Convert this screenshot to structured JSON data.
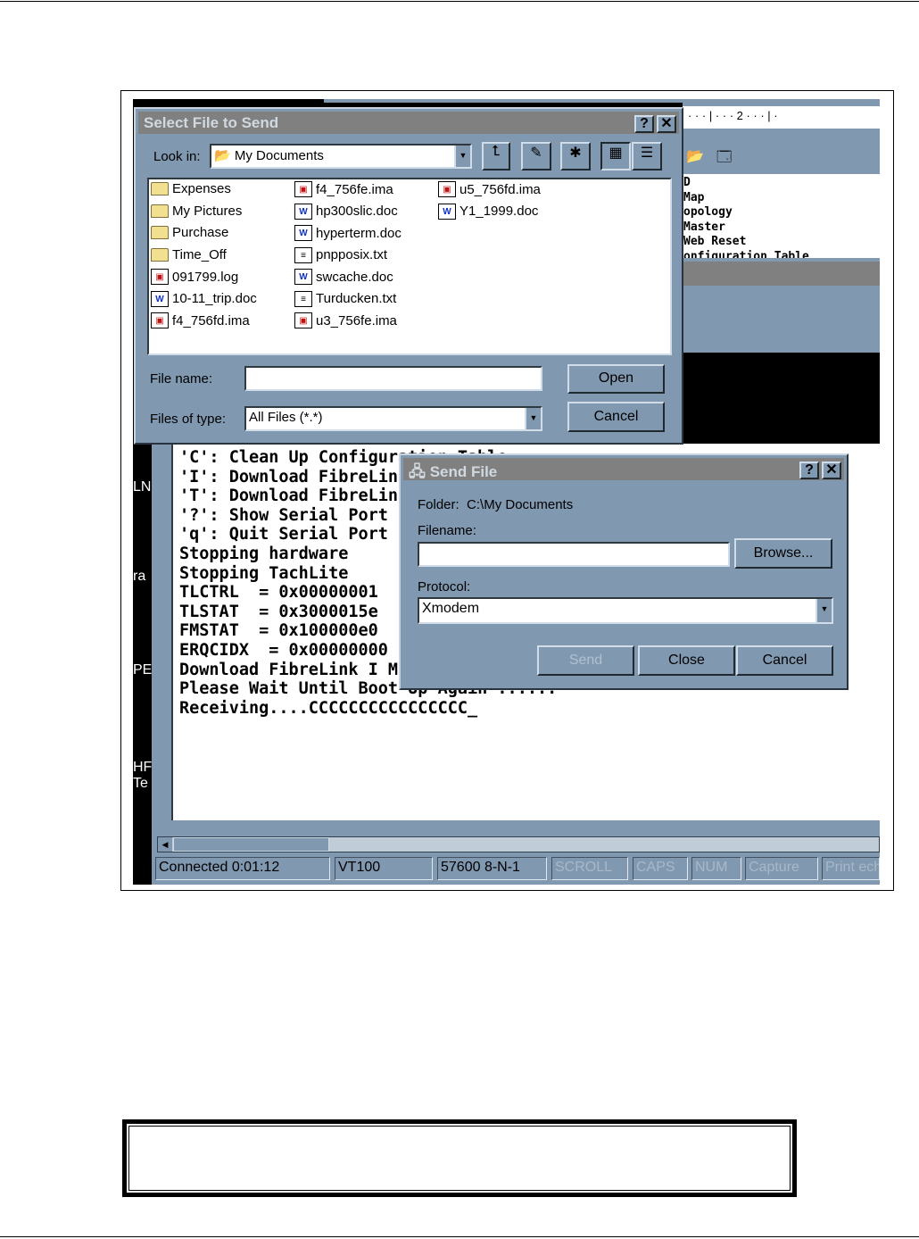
{
  "select_dialog": {
    "title": "Select File to Send",
    "look_in_label": "Look in:",
    "look_in_value": "My Documents",
    "files": [
      {
        "name": "Expenses",
        "type": "folder"
      },
      {
        "name": "My Pictures",
        "type": "folder"
      },
      {
        "name": "Purchase",
        "type": "folder"
      },
      {
        "name": "Time_Off",
        "type": "folder"
      },
      {
        "name": "091799.log",
        "type": "ima"
      },
      {
        "name": "10-11_trip.doc",
        "type": "doc"
      },
      {
        "name": "f4_756fd.ima",
        "type": "ima"
      },
      {
        "name": "f4_756fe.ima",
        "type": "ima"
      },
      {
        "name": "hp300slic.doc",
        "type": "doc"
      },
      {
        "name": "hyperterm.doc",
        "type": "doc"
      },
      {
        "name": "pnpposix.txt",
        "type": "txt"
      },
      {
        "name": "swcache.doc",
        "type": "doc"
      },
      {
        "name": "Turducken.txt",
        "type": "txt"
      },
      {
        "name": "u3_756fe.ima",
        "type": "ima"
      },
      {
        "name": "u5_756fd.ima",
        "type": "ima"
      },
      {
        "name": "Y1_1999.doc",
        "type": "doc"
      }
    ],
    "file_name_label": "File name:",
    "file_name_value": "",
    "files_of_type_label": "Files of type:",
    "files_of_type_value": "All Files (*.*)",
    "open_label": "Open",
    "cancel_label": "Cancel"
  },
  "background_app": {
    "ruler": "· · · | · · · 2 · · · | ·",
    "lines": [
      "D",
      "Map",
      "opology",
      "Master",
      "Web Reset",
      "onfiguration Table"
    ]
  },
  "terminal": {
    "lines": [
      "'C': Clean Up Configuration Table",
      "'I': Download FibreLink I Microcode",
      "'T': Download FibreLink T Microcode",
      "'?': Show Serial Port",
      "'q': Quit Serial Port",
      "Stopping hardware",
      "Stopping TachLite",
      "TLCTRL  = 0x00000001",
      "TLSTAT  = 0x3000015e",
      "FMSTAT  = 0x100000e0",
      "ERQCIDX  = 0x00000000",
      "",
      "Download FibreLink I Microcode From Local Computer",
      "",
      "",
      "Please Wait Until Boot Up Again ......",
      "",
      "",
      "Receiving....CCCCCCCCCCCCCCCC_"
    ],
    "desktop_labels": [
      "LN",
      "ra",
      "PE",
      "HF",
      "Te"
    ]
  },
  "status_bar": [
    "Connected 0:01:12",
    "VT100",
    "57600 8-N-1",
    "SCROLL",
    "CAPS",
    "NUM",
    "Capture",
    "Print ech"
  ],
  "send_dialog": {
    "title": "Send File",
    "folder_label": "Folder:",
    "folder_value": "C:\\My Documents",
    "filename_label": "Filename:",
    "filename_value": "",
    "browse_label": "Browse...",
    "protocol_label": "Protocol:",
    "protocol_value": "Xmodem",
    "send_label": "Send",
    "close_label": "Close",
    "cancel_label": "Cancel"
  }
}
